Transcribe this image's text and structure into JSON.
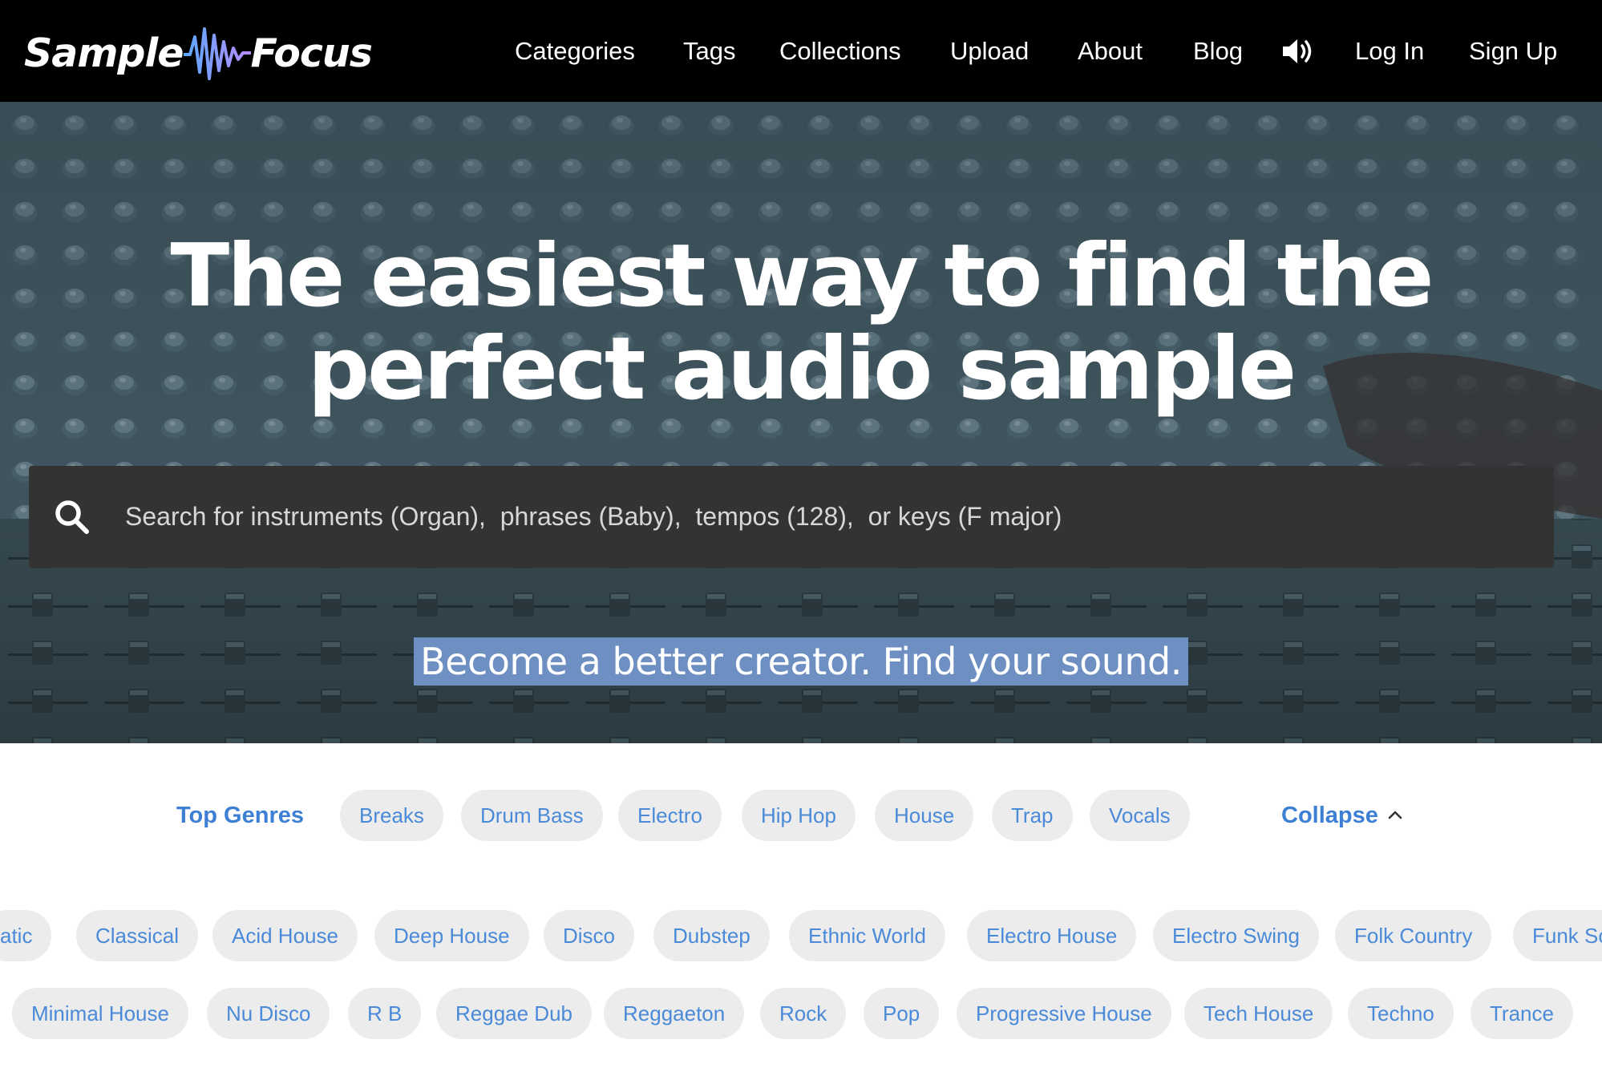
{
  "brand": {
    "left": "Sample",
    "right": "Focus"
  },
  "nav": {
    "items": [
      "Categories",
      "Tags",
      "Collections",
      "Upload",
      "About",
      "Blog"
    ],
    "sound_icon": "speaker-volume-icon",
    "login": "Log In",
    "signup": "Sign Up"
  },
  "hero": {
    "title": "The easiest way to find the perfect audio sample",
    "search_placeholder": "Search for instruments (Organ),  phrases (Baby),  tempos (128),  or keys (F major)",
    "search_icon": "search-icon",
    "tagline": "Become a better creator. Find your sound."
  },
  "genres": {
    "top_label": "Top Genres",
    "top": [
      "Breaks",
      "Drum Bass",
      "Electro",
      "Hip Hop",
      "House",
      "Trap",
      "Vocals"
    ],
    "collapse": "Collapse",
    "collapse_icon": "chevron-up-icon",
    "row1": [
      "atic",
      "Classical",
      "Acid House",
      "Deep House",
      "Disco",
      "Dubstep",
      "Ethnic World",
      "Electro House",
      "Electro Swing",
      "Folk Country",
      "Funk So"
    ],
    "row2": [
      "Minimal House",
      "Nu Disco",
      "R B",
      "Reggae Dub",
      "Reggaeton",
      "Rock",
      "Pop",
      "Progressive House",
      "Tech House",
      "Techno",
      "Trance"
    ]
  },
  "colors": {
    "nav_bg": "#000000",
    "accent_blue": "#3d7fd4",
    "chip_bg": "#ececec",
    "search_bg": "#333333",
    "highlight": "#6d8fc2"
  }
}
